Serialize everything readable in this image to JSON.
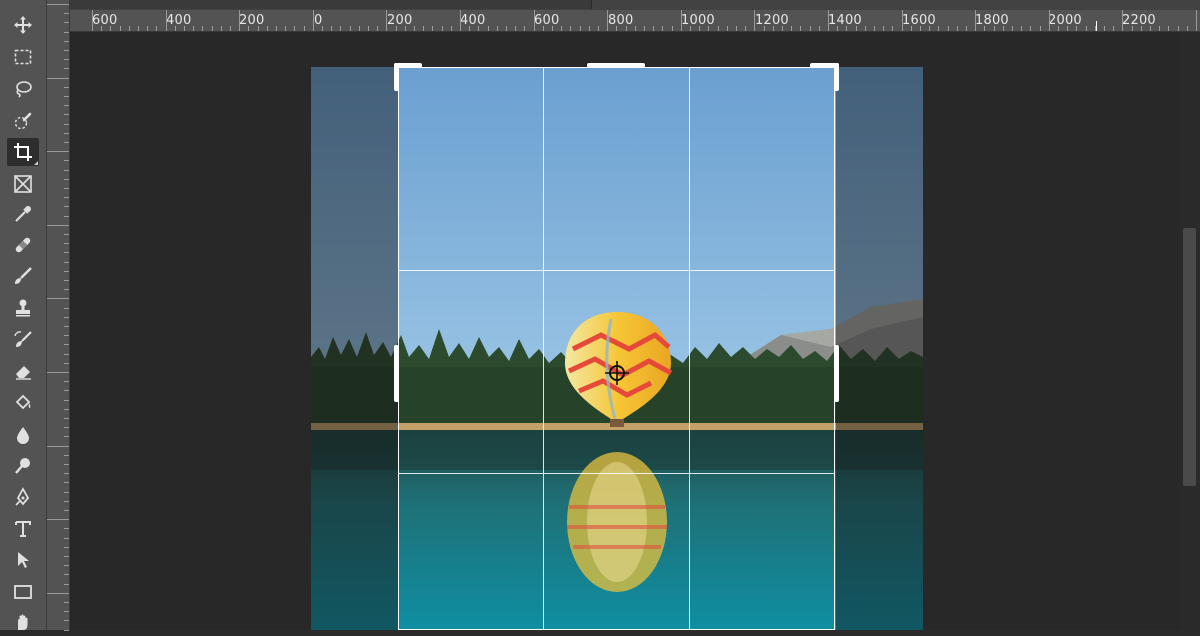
{
  "toolbar": {
    "tools": [
      {
        "name": "move-tool",
        "icon": "move-icon",
        "active": false
      },
      {
        "name": "marquee-tool",
        "icon": "rect-marquee-icon",
        "active": false
      },
      {
        "name": "lasso-tool",
        "icon": "lasso-icon",
        "active": false
      },
      {
        "name": "quick-selection-tool",
        "icon": "quick-selection-icon",
        "active": false
      },
      {
        "name": "crop-tool",
        "icon": "crop-icon",
        "active": true
      },
      {
        "name": "frame-tool",
        "icon": "frame-icon",
        "active": false
      },
      {
        "name": "eyedropper-tool",
        "icon": "eyedropper-icon",
        "active": false
      },
      {
        "name": "healing-brush-tool",
        "icon": "bandage-icon",
        "active": false
      },
      {
        "name": "brush-tool",
        "icon": "brush-icon",
        "active": false
      },
      {
        "name": "clone-stamp-tool",
        "icon": "stamp-icon",
        "active": false
      },
      {
        "name": "history-brush-tool",
        "icon": "history-brush-icon",
        "active": false
      },
      {
        "name": "eraser-tool",
        "icon": "eraser-icon",
        "active": false
      },
      {
        "name": "paint-bucket-tool",
        "icon": "paint-bucket-icon",
        "active": false
      },
      {
        "name": "blur-tool",
        "icon": "drop-icon",
        "active": false
      },
      {
        "name": "dodge-tool",
        "icon": "dodge-icon",
        "active": false
      },
      {
        "name": "pen-tool",
        "icon": "pen-icon",
        "active": false
      },
      {
        "name": "type-tool",
        "icon": "type-icon",
        "active": false
      },
      {
        "name": "path-selection-tool",
        "icon": "arrow-icon",
        "active": false
      },
      {
        "name": "rectangle-tool",
        "icon": "rectangle-icon",
        "active": false
      },
      {
        "name": "hand-tool",
        "icon": "hand-icon",
        "active": false
      }
    ]
  },
  "ruler": {
    "labels": [
      "600",
      "400",
      "200",
      "0",
      "200",
      "400",
      "600",
      "800",
      "1000",
      "1200",
      "1400",
      "1600",
      "1800",
      "2000",
      "2200"
    ]
  },
  "crop": {
    "grid": "rule-of-thirds"
  },
  "colors": {
    "toolbar_bg": "#535353",
    "canvas_bg": "#282828",
    "crop_border": "#ffffff"
  }
}
